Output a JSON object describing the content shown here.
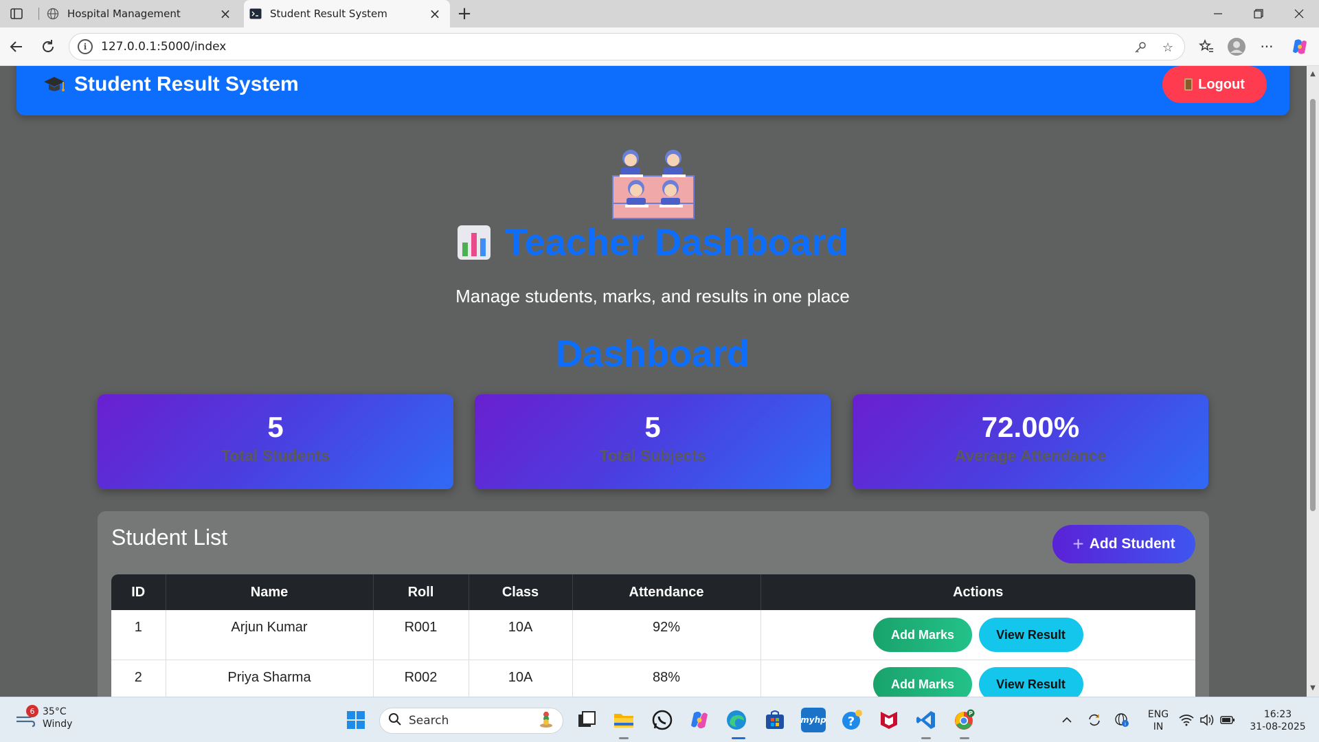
{
  "browser": {
    "tabs": [
      {
        "title": "Hospital Management",
        "active": false
      },
      {
        "title": "Student Result System",
        "active": true
      }
    ],
    "url": "127.0.0.1:5000/index"
  },
  "navbar": {
    "brand": "Student Result System",
    "logout_label": "Logout"
  },
  "hero": {
    "title": "Teacher Dashboard",
    "subtitle": "Manage students, marks, and results in one place",
    "section_title": "Dashboard"
  },
  "stats": [
    {
      "value": "5",
      "label": "Total Students"
    },
    {
      "value": "5",
      "label": "Total Subjects"
    },
    {
      "value": "72.00%",
      "label": "Average Attendance"
    }
  ],
  "student_list": {
    "title": "Student List",
    "add_button": "Add Student",
    "columns": [
      "ID",
      "Name",
      "Roll",
      "Class",
      "Attendance",
      "Actions"
    ],
    "rows": [
      {
        "id": "1",
        "name": "Arjun Kumar",
        "roll": "R001",
        "class": "10A",
        "attendance": "92%"
      },
      {
        "id": "2",
        "name": "Priya Sharma",
        "roll": "R002",
        "class": "10A",
        "attendance": "88%"
      }
    ],
    "add_marks_label": "Add Marks",
    "view_result_label": "View Result"
  },
  "taskbar": {
    "weather_temp": "35°C",
    "weather_desc": "Windy",
    "weather_badge": "6",
    "search_label": "Search",
    "lang_line1": "ENG",
    "lang_line2": "IN",
    "time": "16:23",
    "date": "31-08-2025"
  },
  "colors": {
    "navbar": "#0d6efd",
    "logout": "#ff3b4f",
    "heading": "#0d6efd",
    "page_bg": "#5f6060"
  }
}
